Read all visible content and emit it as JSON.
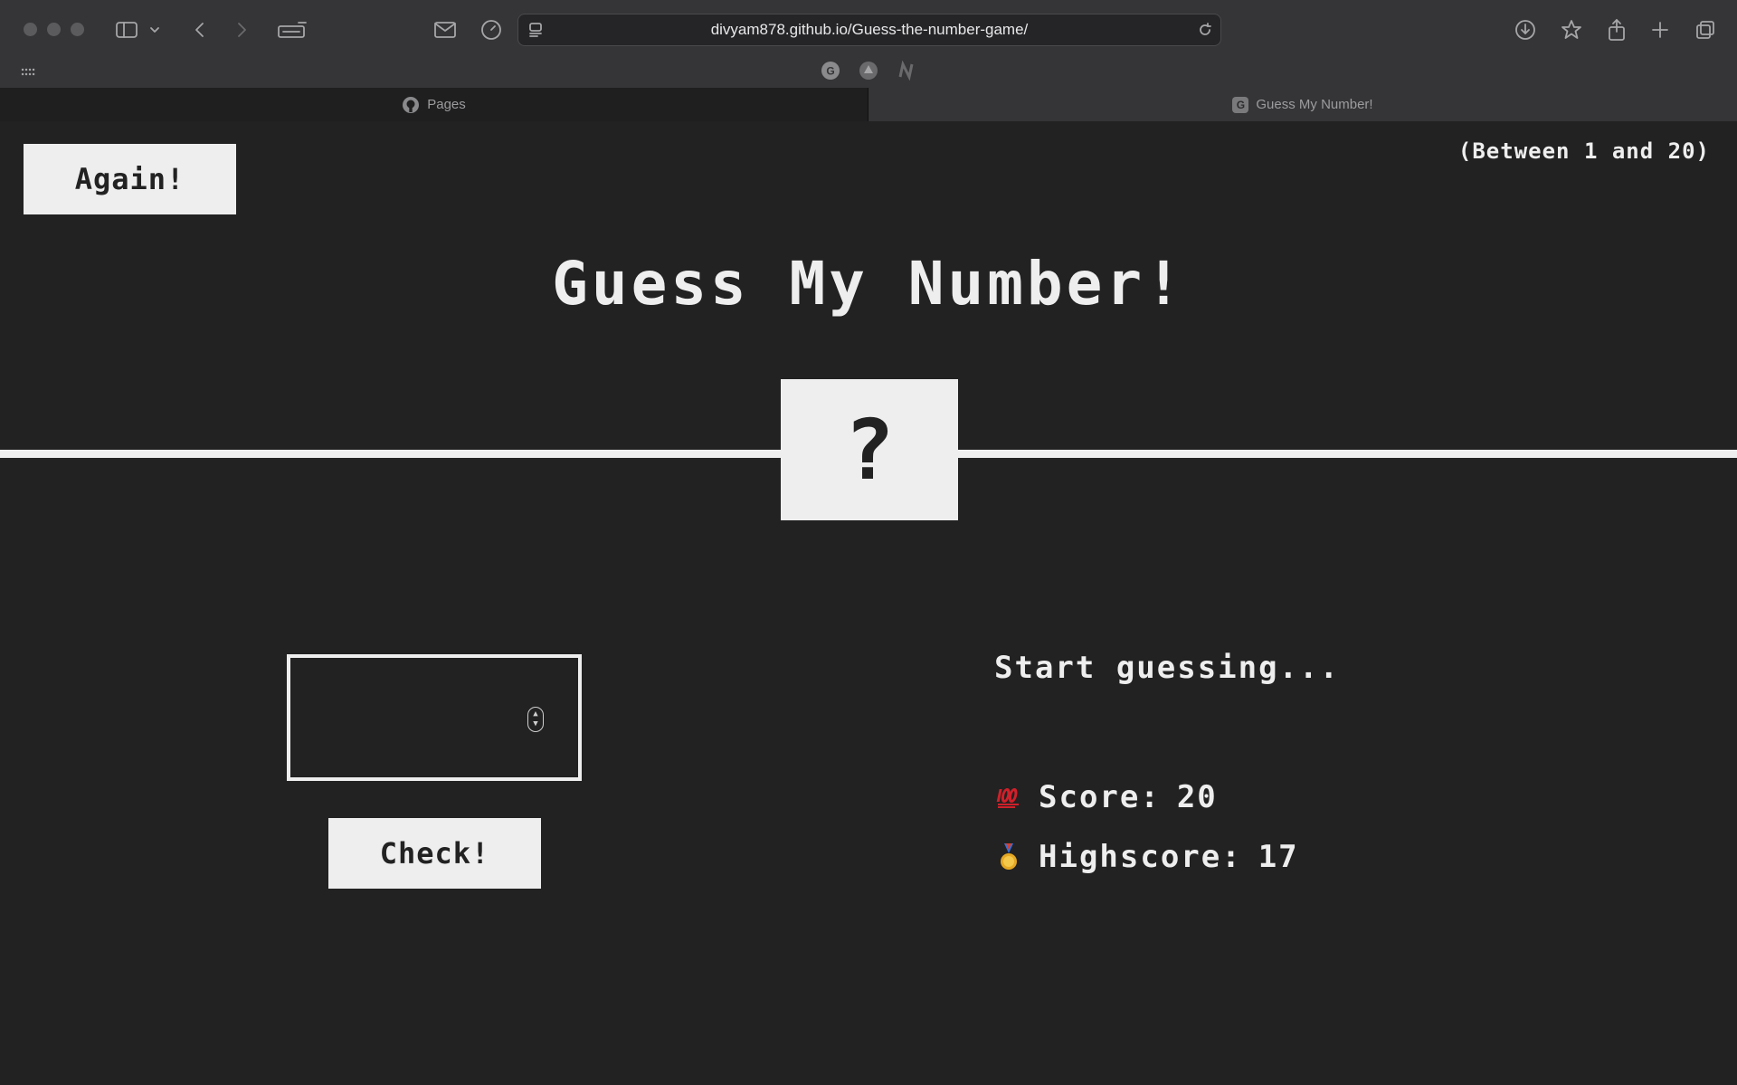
{
  "browser": {
    "url": "divyam878.github.io/Guess-the-number-game/",
    "tabs": [
      {
        "label": "Pages",
        "active": false,
        "icon": "github-icon"
      },
      {
        "label": "Guess My Number!",
        "active": true,
        "icon": "g-favicon"
      }
    ]
  },
  "game": {
    "again_label": "Again!",
    "range_hint": "(Between 1 and 20)",
    "title": "Guess My Number!",
    "secret_display": "?",
    "guess_value": "",
    "check_label": "Check!",
    "message": "Start guessing...",
    "score_label": "Score:",
    "score_value": "20",
    "highscore_label": "Highscore:",
    "highscore_value": "17"
  },
  "colors": {
    "background": "#222222",
    "foreground": "#eeeeee"
  }
}
